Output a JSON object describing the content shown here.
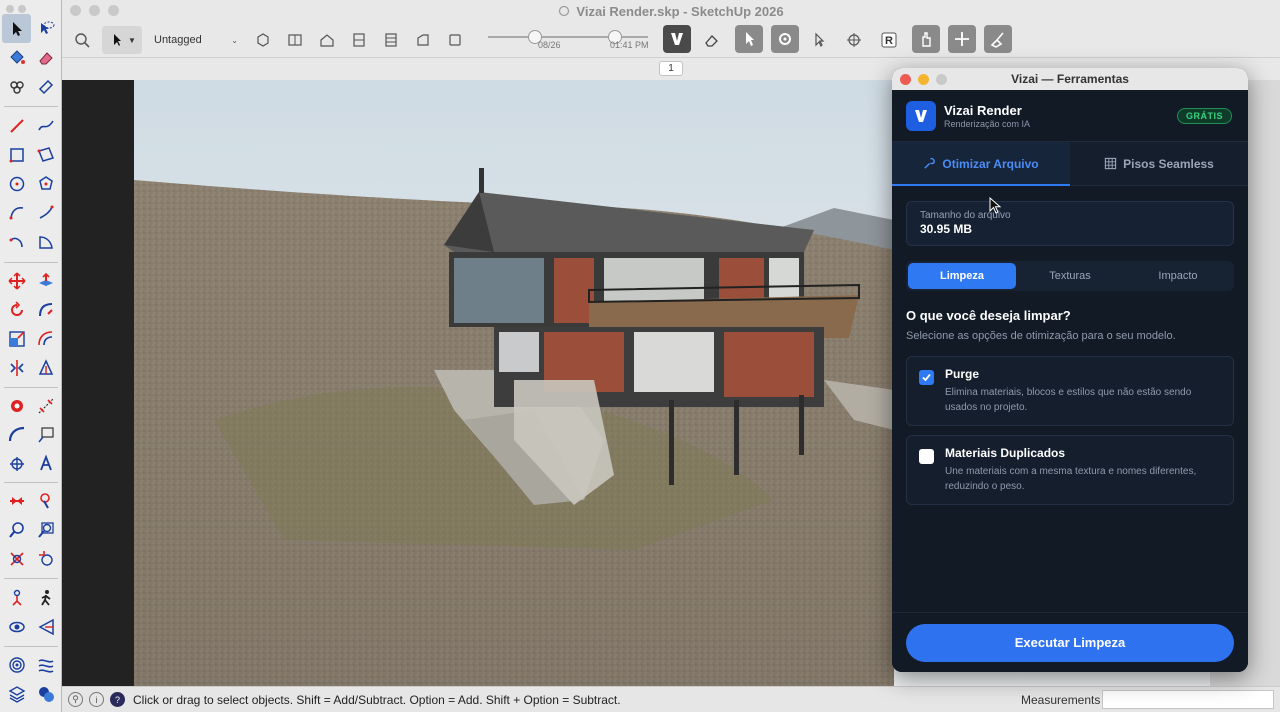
{
  "window": {
    "title": "Vizai Render.skp - SketchUp 2026"
  },
  "toolbar": {
    "tag_value": "Untagged",
    "date_label": "08/26",
    "time_label": "01:41 PM"
  },
  "scene_tab": "1",
  "statusbar": {
    "message": "Click or drag to select objects. Shift = Add/Subtract. Option = Add. Shift + Option = Subtract.",
    "measurements_label": "Measurements",
    "measurements_value": ""
  },
  "vizai": {
    "window_title": "Vizai — Ferramentas",
    "brand_name": "Vizai Render",
    "brand_sub": "Renderização com IA",
    "badge": "GRÁTIS",
    "tabs": [
      {
        "label": "Otimizar Arquivo",
        "icon": "wrench-icon",
        "active": true
      },
      {
        "label": "Pisos Seamless",
        "icon": "grid-icon",
        "active": false
      }
    ],
    "file_size_label": "Tamanho do arquivo",
    "file_size_value": "30.95 MB",
    "segments": [
      {
        "label": "Limpeza",
        "active": true
      },
      {
        "label": "Texturas",
        "active": false
      },
      {
        "label": "Impacto",
        "active": false
      }
    ],
    "question": "O que você deseja limpar?",
    "question_sub": "Selecione as opções de otimização para o seu modelo.",
    "options": [
      {
        "title": "Purge",
        "desc": "Elimina materiais, blocos e estilos que não estão sendo usados no projeto.",
        "checked": true
      },
      {
        "title": "Materiais Duplicados",
        "desc": "Une materiais com a mesma textura e nomes diferentes, reduzindo o peso.",
        "checked": false
      }
    ],
    "run_button": "Executar Limpeza"
  },
  "colors": {
    "accent": "#2f79f2",
    "badge_green": "#39d37e",
    "panel_bg": "#121a26"
  }
}
